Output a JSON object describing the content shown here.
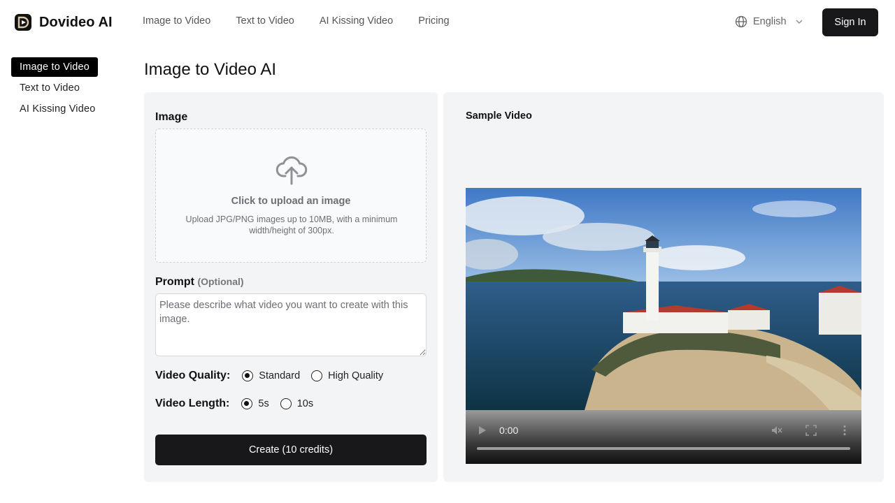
{
  "brand": {
    "name": "Dovideo AI"
  },
  "nav": {
    "items": [
      "Image to Video",
      "Text to Video",
      "AI Kissing Video",
      "Pricing"
    ]
  },
  "header": {
    "language": "English",
    "sign_in": "Sign In"
  },
  "sidebar": {
    "items": [
      {
        "label": "Image to Video",
        "active": true
      },
      {
        "label": "Text to Video",
        "active": false
      },
      {
        "label": "AI Kissing Video",
        "active": false
      }
    ]
  },
  "main": {
    "title": "Image to Video AI",
    "image_label": "Image",
    "upload": {
      "title": "Click to upload an image",
      "hint": "Upload JPG/PNG images up to 10MB, with a minimum width/height of 300px."
    },
    "prompt": {
      "label": "Prompt",
      "optional": "(Optional)",
      "placeholder": "Please describe what video you want to create with this image.",
      "value": ""
    },
    "quality": {
      "label": "Video Quality:",
      "options": [
        "Standard",
        "High Quality"
      ],
      "selected": "Standard"
    },
    "length": {
      "label": "Video Length:",
      "options": [
        "5s",
        "10s"
      ],
      "selected": "5s"
    },
    "create_button": "Create (10 credits)"
  },
  "sample": {
    "title": "Sample Video",
    "time": "0:00"
  },
  "colors": {
    "accent": "#18181b",
    "panel": "#f3f4f6",
    "text": "#111111",
    "muted": "#6b6f75"
  }
}
